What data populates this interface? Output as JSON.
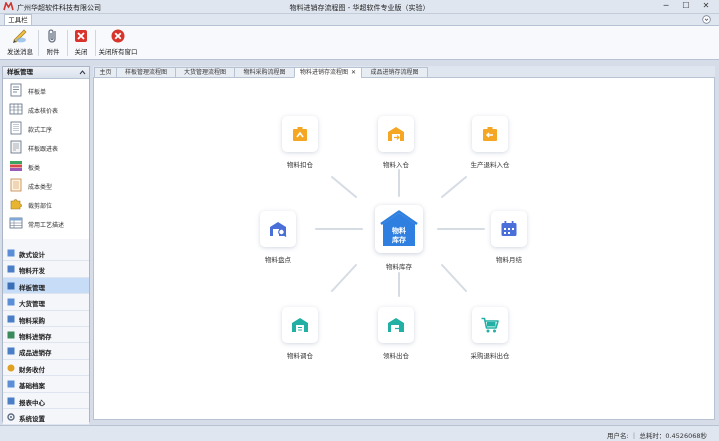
{
  "window": {
    "company": "广州华超软件科技有限公司",
    "title": "物料进销存流程图 - 华超软件专业版（实验）",
    "minimize": "─",
    "maximize": "☐",
    "close": "✕"
  },
  "ribbon": {
    "tab": "工具栏",
    "buttons": [
      {
        "label": "发送消息",
        "icon": "pencil-message-icon"
      },
      {
        "label": "附件",
        "icon": "paperclip-icon"
      },
      {
        "label": "关闭",
        "icon": "close-box-icon"
      },
      {
        "label": "关闭所有窗口",
        "icon": "close-circle-icon"
      }
    ]
  },
  "sidebar": {
    "header": "样板管理",
    "sub_items": [
      {
        "label": "样板单"
      },
      {
        "label": "成本核价表"
      },
      {
        "label": "款式工序"
      },
      {
        "label": "样板跟进表"
      },
      {
        "label": "板类"
      },
      {
        "label": "成本类型"
      },
      {
        "label": "裁剪部位"
      },
      {
        "label": "常用工艺描述"
      }
    ],
    "nav": [
      {
        "label": "款式设计",
        "active": false
      },
      {
        "label": "物料开发",
        "active": false
      },
      {
        "label": "样板管理",
        "active": true
      },
      {
        "label": "大货管理",
        "active": false
      },
      {
        "label": "物料采购",
        "active": false
      },
      {
        "label": "物料进销存",
        "active": false
      },
      {
        "label": "成品进销存",
        "active": false
      },
      {
        "label": "财务收付",
        "active": false
      },
      {
        "label": "基础档案",
        "active": false
      },
      {
        "label": "报表中心",
        "active": false
      },
      {
        "label": "系统设置",
        "active": false
      }
    ]
  },
  "doc_tabs": [
    {
      "label": "主页",
      "active": false
    },
    {
      "label": "样板管理流程图",
      "active": false
    },
    {
      "label": "大货管理流程图",
      "active": false
    },
    {
      "label": "物料采购流程图",
      "active": false
    },
    {
      "label": "物料进销存流程图",
      "active": true,
      "close": "✕"
    },
    {
      "label": "成品进销存流程图",
      "active": false
    }
  ],
  "flow": {
    "center": {
      "label": "物料库存",
      "icon_text_1": "物料",
      "icon_text_2": "库存",
      "color": "#2f7fe0"
    },
    "nodes": [
      {
        "label": "物料扣仓",
        "icon": "box-arrow-icon",
        "color": "#f5a623"
      },
      {
        "label": "物料入仓",
        "icon": "warehouse-in-icon",
        "color": "#f5a623"
      },
      {
        "label": "生产退料入仓",
        "icon": "return-box-icon",
        "color": "#f5a623"
      },
      {
        "label": "物料盘点",
        "icon": "warehouse-search-icon",
        "color": "#4a6fd8"
      },
      {
        "label": "物料月结",
        "icon": "calendar-icon",
        "color": "#4a6fd8"
      },
      {
        "label": "物料调仓",
        "icon": "warehouse-transfer-icon",
        "color": "#22b0a4"
      },
      {
        "label": "领料出仓",
        "icon": "warehouse-out-icon",
        "color": "#22b0a4"
      },
      {
        "label": "采购退料出仓",
        "icon": "cart-icon",
        "color": "#22b0a4"
      }
    ]
  },
  "status": {
    "text": "用户名:     ｜ 总耗时：0.4526068秒"
  }
}
